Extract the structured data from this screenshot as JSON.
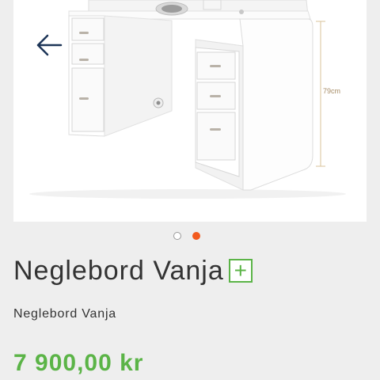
{
  "gallery": {
    "image_alt": "Neglebord Vanja",
    "dimension_label": "79cm",
    "prev_icon": "arrow-left-icon",
    "slides_total": 2,
    "active_slide": 2
  },
  "product": {
    "title": "Neglebord Vanja",
    "add_icon": "plus-icon",
    "add_symbol": "+",
    "subtitle": "Neglebord Vanja",
    "price": "7 900,00 kr"
  },
  "colors": {
    "accent_green": "#5bb447",
    "active_dot": "#f25a1e",
    "background": "#eeeeee"
  }
}
